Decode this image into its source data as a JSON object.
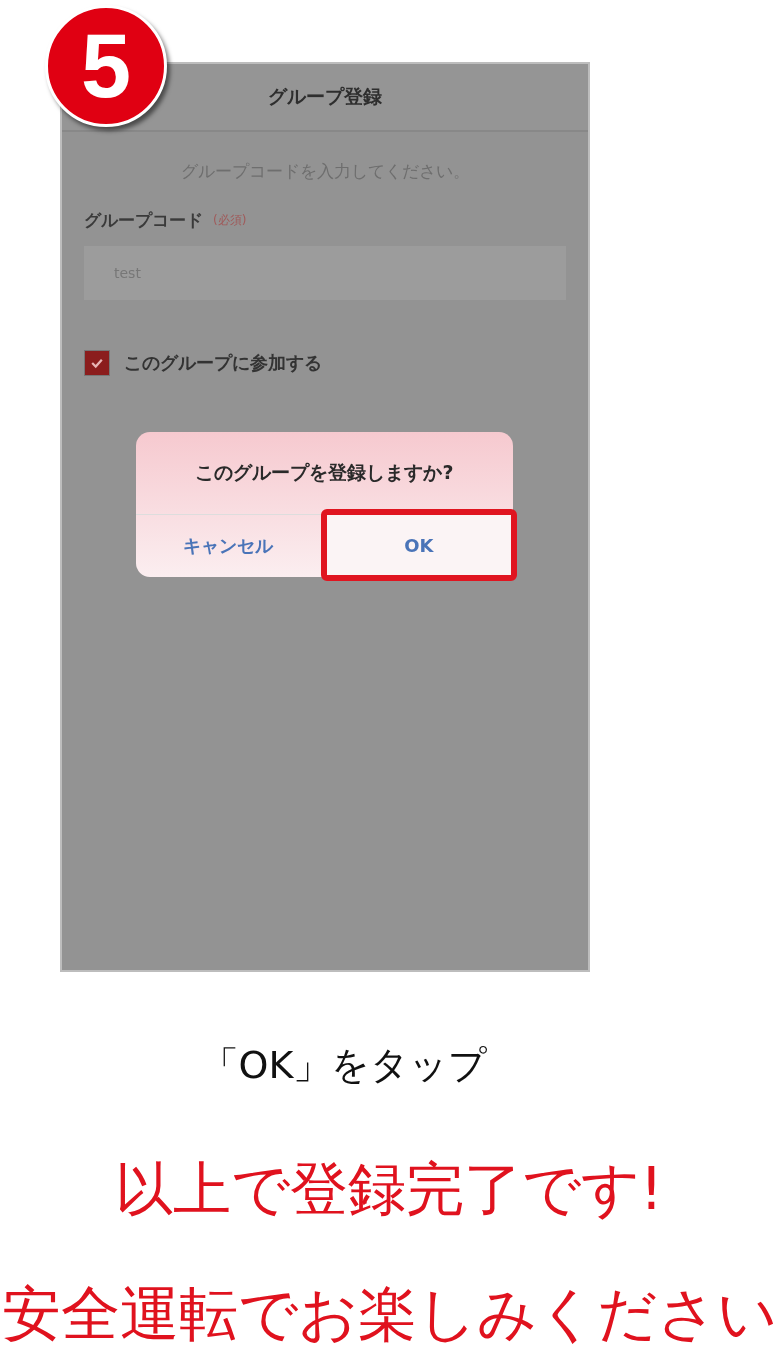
{
  "step_badge": "5",
  "screen": {
    "title": "グループ登録",
    "instruction": "グループコードを入力してください。",
    "field": {
      "label": "グループコード",
      "required": "(必須)",
      "value": "test"
    },
    "checkbox": {
      "label": "このグループに参加する",
      "checked": true
    }
  },
  "dialog": {
    "message": "このグループを登録しますか?",
    "buttons": [
      {
        "label": "キャンセル",
        "highlighted": false
      },
      {
        "label": "OK",
        "highlighted": true
      }
    ]
  },
  "captions": [
    {
      "text": "「OK」をタップ",
      "kind": "instruction"
    },
    {
      "text": "以上で登録完了です!",
      "kind": "emphasis"
    },
    {
      "text": "安全運転でお楽しみください",
      "kind": "emphasis"
    }
  ]
}
